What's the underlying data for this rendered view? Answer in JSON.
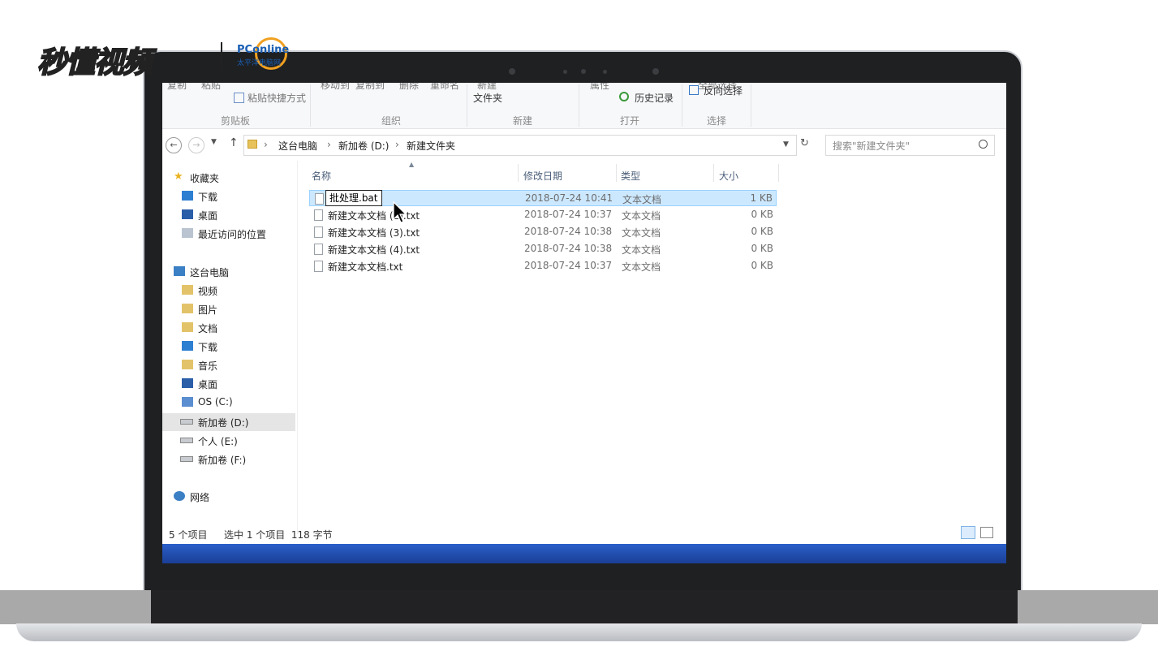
{
  "watermark": {
    "brand": "秒懂视频",
    "partner": "PConline",
    "partner_sub": "太平洋电脑网"
  },
  "ribbon": {
    "row_top": [
      "复制",
      "粘贴",
      "移动到",
      "复制到",
      "删除",
      "重命名",
      "新建",
      "属性",
      "全部选择"
    ],
    "paste_shortcut": "粘贴快捷方式",
    "new_folder": "文件夹",
    "history": "历史记录",
    "invert_select": "反向选择",
    "groups": [
      "剪贴板",
      "组织",
      "新建",
      "打开",
      "选择"
    ]
  },
  "address": {
    "crumbs": [
      "这台电脑",
      "新加卷 (D:)",
      "新建文件夹"
    ],
    "search_placeholder": "搜索\"新建文件夹\""
  },
  "sidebar": {
    "favorites_header": "收藏夹",
    "favorites": [
      "下载",
      "桌面",
      "最近访问的位置"
    ],
    "pc_header": "这台电脑",
    "pc_items": [
      "视频",
      "图片",
      "文档",
      "下载",
      "音乐",
      "桌面",
      "OS (C:)",
      "新加卷 (D:)",
      "个人 (E:)",
      "新加卷 (F:)"
    ],
    "network": "网络"
  },
  "columns": {
    "name": "名称",
    "date": "修改日期",
    "type": "类型",
    "size": "大小"
  },
  "files": [
    {
      "name": "批处理.bat",
      "date": "2018-07-24 10:41",
      "type": "文本文档",
      "size": "1 KB"
    },
    {
      "name": "新建文本文档 (2).txt",
      "date": "2018-07-24 10:37",
      "type": "文本文档",
      "size": "0 KB"
    },
    {
      "name": "新建文本文档 (3).txt",
      "date": "2018-07-24 10:38",
      "type": "文本文档",
      "size": "0 KB"
    },
    {
      "name": "新建文本文档 (4).txt",
      "date": "2018-07-24 10:38",
      "type": "文本文档",
      "size": "0 KB"
    },
    {
      "name": "新建文本文档.txt",
      "date": "2018-07-24 10:37",
      "type": "文本文档",
      "size": "0 KB"
    }
  ],
  "status": {
    "count": "5 个项目",
    "selection": "选中 1 个项目  118 字节"
  },
  "colors": {
    "selection_bg": "#cce8ff",
    "taskbar": "#1f4fb4"
  }
}
